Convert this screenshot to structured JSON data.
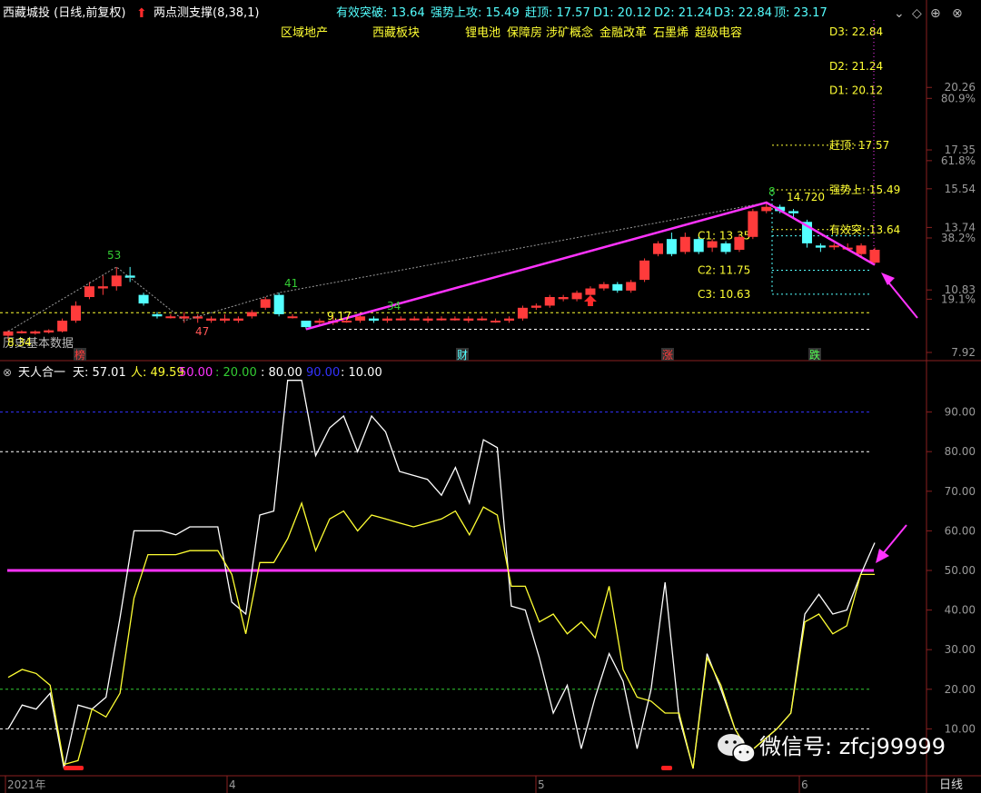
{
  "colors": {
    "bg": "#000000",
    "up": "#ff3b3b",
    "down": "#54ffff",
    "magenta": "#ff33ff",
    "yellow": "#ffff33",
    "white": "#ffffff",
    "cyan": "#54ffff",
    "green": "#33cc33",
    "blue": "#3333ff",
    "grey": "#9a9a9a",
    "frame": "#8a2020"
  },
  "header": {
    "stock": "西藏城投 (日线,前复权)",
    "indicator": "两点测支撑(8,38,1)",
    "metrics": [
      {
        "label": "有效突破: 13.64",
        "color": "#54ffff"
      },
      {
        "label": "强势上攻: 15.49",
        "color": "#54ffff"
      },
      {
        "label": "赶顶: 17.57",
        "color": "#54ffff"
      },
      {
        "label": "D1: 20.12",
        "color": "#54ffff"
      },
      {
        "label": "D2: 21.24",
        "color": "#54ffff"
      },
      {
        "label": "D3: 22.84",
        "color": "#54ffff"
      },
      {
        "label": "顶: 23.17",
        "color": "#54ffff"
      }
    ],
    "concepts": [
      "区域地产",
      "西藏板块",
      "锂电池",
      "保障房",
      "涉矿概念",
      "金融改革",
      "石墨烯",
      "超级电容"
    ]
  },
  "upper_axis": [
    {
      "label": "20.26",
      "val": 20.26
    },
    {
      "label": "80.9%",
      "val": 19.75
    },
    {
      "label": "17.35",
      "val": 17.35
    },
    {
      "label": "61.8%",
      "val": 16.85
    },
    {
      "label": "15.54",
      "val": 15.54
    },
    {
      "label": "13.74",
      "val": 13.74
    },
    {
      "label": "38.2%",
      "val": 13.25
    },
    {
      "label": "10.83",
      "val": 10.83
    },
    {
      "label": "19.1%",
      "val": 10.4
    },
    {
      "label": "7.92",
      "val": 7.92
    }
  ],
  "upper_levels": [
    {
      "label": "D3: 22.84",
      "val": 22.84
    },
    {
      "label": "D2: 21.24",
      "val": 21.24
    },
    {
      "label": "D1: 20.12",
      "val": 20.12
    },
    {
      "label": "赶顶: 17.57",
      "val": 17.57
    },
    {
      "label": "强势上: 15.49",
      "val": 15.49
    },
    {
      "label": "有效突: 13.64",
      "val": 13.64
    },
    {
      "label": "C1: 13.35",
      "val": 13.35
    },
    {
      "label": "C2: 11.75",
      "val": 11.75
    },
    {
      "label": "C3: 10.63",
      "val": 10.63
    }
  ],
  "candle_labels": {
    "low_start": "8.34",
    "hist": "历史基本数据",
    "mid_low": "9.17",
    "left_peak": "53",
    "left_low": "47",
    "mark_41": "41",
    "mark_34": "34",
    "mark_8": "8",
    "peak_price": "14.720"
  },
  "event_tags": [
    {
      "label": "榜",
      "color": "#ff3b3b"
    },
    {
      "label": "财",
      "color": "#54ffff"
    },
    {
      "label": "涨",
      "color": "#ff3b3b"
    },
    {
      "label": "跌",
      "color": "#54ff54"
    }
  ],
  "lower_header": {
    "name": "天人合一",
    "items": [
      {
        "label": "天: 57.01",
        "color": "#ffffff"
      },
      {
        "label": "人: 49.59",
        "color": "#ffff33"
      },
      {
        "label": "50.00",
        "color": "#ff33ff"
      },
      {
        "label": ": 20.00",
        "color": "#33cc33"
      },
      {
        "label": ": 80.00",
        "color": "#ffffff"
      },
      {
        "label": "90.00",
        "color": "#3333ff"
      },
      {
        "label": ": 10.00",
        "color": "#ffffff"
      }
    ]
  },
  "lower_axis": [
    "90.00",
    "80.00",
    "70.00",
    "60.00",
    "50.00",
    "40.00",
    "30.00",
    "20.00",
    "10.00"
  ],
  "x_labels": [
    "2021年",
    "4",
    "5",
    "6"
  ],
  "period": "日线",
  "watermark": "微信号: zfcj99999",
  "chart_data": [
    {
      "type": "candlestick",
      "ylim": [
        7.92,
        23.4
      ],
      "candles": [
        [
          8.7,
          8.9,
          8.5,
          8.95
        ],
        [
          8.85,
          8.9,
          8.8,
          8.95
        ],
        [
          8.8,
          8.9,
          8.75,
          8.95
        ],
        [
          8.85,
          8.95,
          8.8,
          9.0
        ],
        [
          8.9,
          9.4,
          8.85,
          9.5
        ],
        [
          9.4,
          10.1,
          9.3,
          10.3
        ],
        [
          10.5,
          11.0,
          10.4,
          11.2
        ],
        [
          10.9,
          11.0,
          10.6,
          11.5
        ],
        [
          11.0,
          11.5,
          10.8,
          11.9
        ],
        [
          11.5,
          11.4,
          11.2,
          11.9
        ],
        [
          10.6,
          10.2,
          10.1,
          10.7
        ],
        [
          9.7,
          9.6,
          9.5,
          9.8
        ],
        [
          9.6,
          9.6,
          9.5,
          9.7
        ],
        [
          9.5,
          9.6,
          9.3,
          9.8
        ],
        [
          9.5,
          9.6,
          9.3,
          9.7
        ],
        [
          9.4,
          9.5,
          9.3,
          9.6
        ],
        [
          9.4,
          9.5,
          9.3,
          9.7
        ],
        [
          9.4,
          9.5,
          9.3,
          9.6
        ],
        [
          9.6,
          9.8,
          9.5,
          9.9
        ],
        [
          10.0,
          10.4,
          9.9,
          10.5
        ],
        [
          10.6,
          9.7,
          9.6,
          10.7
        ],
        [
          9.6,
          9.6,
          9.5,
          9.7
        ],
        [
          9.4,
          9.1,
          9.0,
          9.4
        ],
        [
          9.3,
          9.4,
          9.2,
          9.5
        ],
        [
          9.3,
          9.4,
          9.2,
          9.6
        ],
        [
          9.4,
          9.4,
          9.3,
          9.5
        ],
        [
          9.4,
          9.6,
          9.3,
          9.7
        ],
        [
          9.5,
          9.4,
          9.3,
          9.6
        ],
        [
          9.4,
          9.5,
          9.3,
          9.6
        ],
        [
          9.5,
          9.5,
          9.4,
          9.6
        ],
        [
          9.5,
          9.5,
          9.4,
          9.6
        ],
        [
          9.4,
          9.5,
          9.3,
          9.6
        ],
        [
          9.5,
          9.5,
          9.4,
          9.6
        ],
        [
          9.5,
          9.5,
          9.4,
          9.6
        ],
        [
          9.4,
          9.5,
          9.3,
          9.6
        ],
        [
          9.5,
          9.5,
          9.4,
          9.6
        ],
        [
          9.4,
          9.4,
          9.3,
          9.5
        ],
        [
          9.4,
          9.5,
          9.3,
          9.6
        ],
        [
          9.5,
          10.0,
          9.4,
          10.1
        ],
        [
          10.0,
          10.1,
          9.9,
          10.2
        ],
        [
          10.1,
          10.5,
          10.0,
          10.6
        ],
        [
          10.4,
          10.5,
          10.3,
          10.6
        ],
        [
          10.4,
          10.7,
          10.3,
          10.8
        ],
        [
          10.6,
          10.9,
          10.5,
          11.0
        ],
        [
          10.9,
          11.1,
          10.8,
          11.2
        ],
        [
          11.1,
          10.8,
          10.7,
          11.2
        ],
        [
          10.8,
          11.2,
          10.7,
          11.3
        ],
        [
          11.3,
          12.2,
          11.2,
          12.3
        ],
        [
          12.5,
          13.0,
          12.4,
          13.1
        ],
        [
          13.2,
          12.5,
          12.4,
          13.5
        ],
        [
          12.6,
          13.3,
          12.5,
          13.5
        ],
        [
          13.2,
          12.6,
          12.5,
          13.3
        ],
        [
          12.8,
          13.1,
          12.6,
          13.2
        ],
        [
          13.0,
          12.6,
          12.5,
          13.1
        ],
        [
          12.7,
          13.3,
          12.6,
          13.4
        ],
        [
          13.3,
          14.5,
          13.2,
          14.6
        ],
        [
          14.5,
          14.7,
          14.4,
          14.9
        ],
        [
          14.7,
          14.5,
          14.4,
          14.8
        ],
        [
          14.5,
          14.4,
          14.2,
          14.6
        ],
        [
          14.0,
          13.0,
          12.8,
          14.1
        ],
        [
          12.9,
          12.8,
          12.6,
          13.0
        ],
        [
          12.9,
          12.9,
          12.7,
          13.0
        ],
        [
          12.8,
          12.8,
          12.7,
          13.0
        ],
        [
          12.5,
          12.9,
          12.4,
          13.0
        ],
        [
          12.1,
          12.7,
          12.0,
          12.8
        ]
      ]
    },
    {
      "type": "line",
      "ylim": [
        0,
        100
      ],
      "series": [
        {
          "name": "天",
          "color": "#ffffff",
          "values": [
            10,
            16,
            15,
            19,
            0,
            16,
            15,
            18,
            38,
            60,
            60,
            60,
            59,
            61,
            61,
            61,
            42,
            39,
            64,
            65,
            98,
            98,
            79,
            86,
            89,
            80,
            89,
            85,
            75,
            74,
            73,
            69,
            76,
            67,
            83,
            81,
            41,
            40,
            28,
            14,
            21,
            5,
            18,
            29,
            22,
            5,
            20,
            47,
            13,
            0,
            29,
            20,
            10,
            4,
            7,
            10,
            14,
            39,
            44,
            39,
            40,
            49,
            57
          ]
        },
        {
          "name": "人",
          "color": "#ffff33",
          "values": [
            23,
            25,
            24,
            21,
            1,
            2,
            15,
            13,
            19,
            43,
            54,
            54,
            54,
            55,
            55,
            55,
            49,
            34,
            52,
            52,
            58,
            67,
            55,
            63,
            65,
            60,
            64,
            63,
            62,
            61,
            62,
            63,
            65,
            59,
            66,
            64,
            46,
            46,
            37,
            39,
            34,
            37,
            33,
            46,
            25,
            18,
            17,
            14,
            14,
            0,
            28,
            21,
            10,
            4,
            7,
            10,
            14,
            37,
            39,
            34,
            36,
            49,
            49
          ]
        }
      ]
    }
  ]
}
